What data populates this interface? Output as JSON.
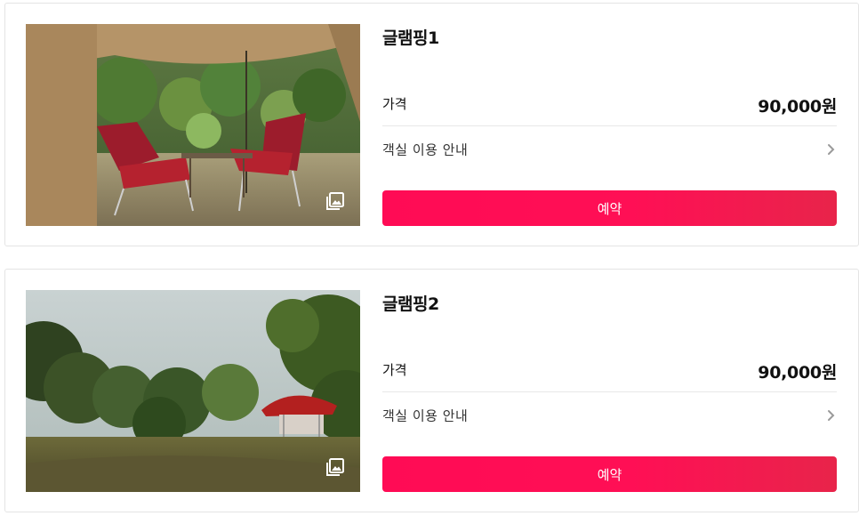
{
  "rooms": [
    {
      "name": "글램핑1",
      "price_label": "가격",
      "price": "90,000원",
      "info_label": "객실 이용 안내",
      "reserve_label": "예약",
      "gallery_icon": "gallery-icon",
      "chevron_icon": "chevron-right-icon"
    },
    {
      "name": "글램핑2",
      "price_label": "가격",
      "price": "90,000원",
      "info_label": "객실 이용 안내",
      "reserve_label": "예약",
      "gallery_icon": "gallery-icon",
      "chevron_icon": "chevron-right-icon"
    }
  ],
  "colors": {
    "accent": "#ff0b55",
    "accent_end": "#e8244a",
    "divider": "#e8e8e8",
    "card_border": "#e4e4e4"
  }
}
